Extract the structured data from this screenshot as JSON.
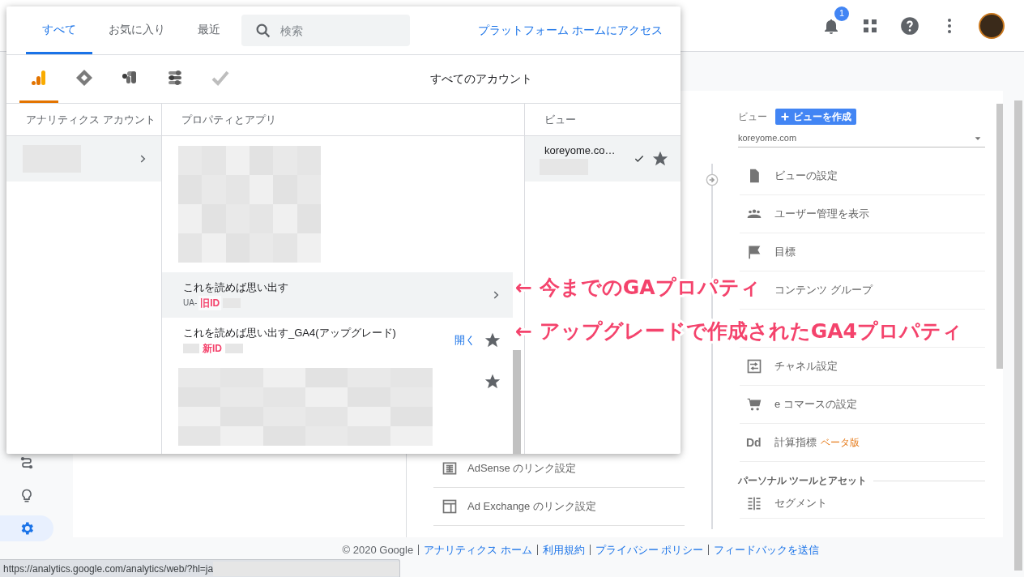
{
  "topbar": {
    "notification_count": "1"
  },
  "rail": {
    "items": [
      {
        "selected": false
      },
      {
        "selected": false
      },
      {
        "selected": true
      }
    ]
  },
  "middle_column": {
    "items": [
      {
        "label": "AdSense のリンク設定"
      },
      {
        "label": "Ad Exchange のリンク設定"
      }
    ]
  },
  "view_column": {
    "label": "ビュー",
    "create_button": "ビューを作成",
    "selector": "koreyome.com",
    "items": [
      {
        "kind": "link",
        "label": "ビューの設定"
      },
      {
        "kind": "link",
        "label": "ユーザー管理を表示"
      },
      {
        "kind": "link",
        "label": "目標"
      },
      {
        "kind": "link",
        "label": "コンテンツ グループ"
      },
      {
        "kind": "covered"
      },
      {
        "kind": "link",
        "label": "チャネル設定"
      },
      {
        "kind": "link",
        "label": "e コマースの設定"
      },
      {
        "kind": "link",
        "icon_text": "Dd",
        "label": "計算指標",
        "badge": "ベータ版"
      }
    ],
    "section": "パーソナル ツールとアセット",
    "section_items": [
      {
        "label": "セグメント"
      }
    ]
  },
  "footer": {
    "copyright": "© 2020 Google",
    "links": [
      "アナリティクス ホーム",
      "利用規約",
      "プライバシー ポリシー",
      "フィードバックを送信"
    ]
  },
  "status_url": "https://analytics.google.com/analytics/web/?hl=ja",
  "picker": {
    "tabs": [
      {
        "label": "すべて",
        "selected": true
      },
      {
        "label": "お気に入り",
        "selected": false
      },
      {
        "label": "最近",
        "selected": false
      }
    ],
    "search": {
      "placeholder": "検索"
    },
    "platform_link": "プラットフォーム ホームにアクセス",
    "products": [
      {
        "selected": true
      },
      {
        "selected": false
      },
      {
        "selected": false
      },
      {
        "selected": false
      },
      {
        "selected": false
      }
    ],
    "scope": "すべてのアカウント",
    "columns": [
      "アナリティクス アカウント",
      "プロパティとアプリ",
      "ビュー"
    ],
    "accounts": [
      {
        "selected": true
      }
    ],
    "properties": [
      {
        "kind": "redacted",
        "selected": false,
        "starred": false
      },
      {
        "kind": "property",
        "name": "これを読めば思い出す",
        "id_prefix": "UA-",
        "id_note": "旧ID",
        "selected": true,
        "starred": false
      },
      {
        "kind": "property",
        "name": "これを読めば思い出す_GA4(アップグレード)",
        "id_note": "新ID",
        "open_link": "開く",
        "selected": false,
        "starred": true
      },
      {
        "kind": "redacted",
        "selected": false,
        "starred": true
      }
    ],
    "views": [
      {
        "name": "koreyome.co…",
        "selected": true,
        "starred": true
      }
    ]
  },
  "annotations": [
    {
      "text": "← 今までのGAプロパティ"
    },
    {
      "text": "← アップグレードで作成されたGA4プロパティ"
    }
  ]
}
